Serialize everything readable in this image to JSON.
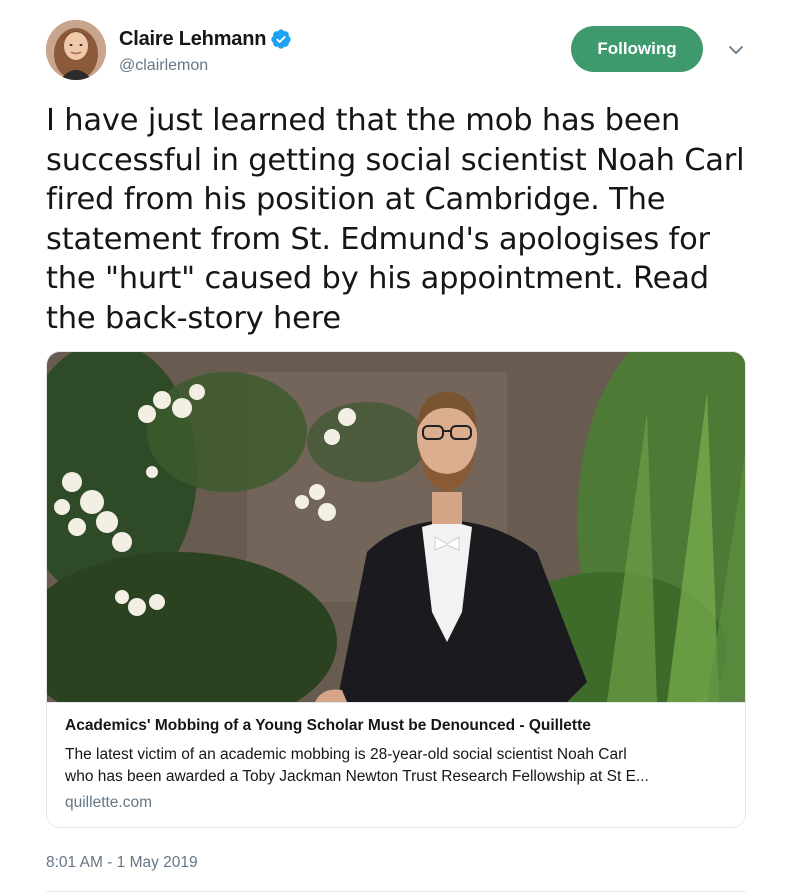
{
  "author": {
    "display_name": "Claire Lehmann",
    "handle": "@clairlemon",
    "verified": true,
    "avatar_icon": "profile-photo"
  },
  "actions": {
    "follow_label": "Following",
    "menu_icon": "chevron-down-icon"
  },
  "tweet": {
    "lines": [
      "I have just learned that the mob has been",
      "successful in getting social scientist Noah Carl",
      "fired from his position at Cambridge. The",
      "statement from St. Edmund's apologises for",
      "the \"hurt\" caused by his appointment. Read",
      "the back-story here"
    ],
    "timestamp": "8:01 AM - 1 May 2019"
  },
  "card": {
    "image_icon": "photo-man-in-academic-gown",
    "title": "Academics' Mobbing of a Young Scholar Must be Denounced - Quillette",
    "desc_lines": [
      "The latest victim of an academic mobbing is 28-year-old social scientist Noah Carl",
      "who has been awarded a Toby Jackman Newton Trust Research Fellowship at St E..."
    ],
    "domain": "quillette.com"
  },
  "colors": {
    "follow_bg": "#3e9a6d",
    "verified": "#1da1f2",
    "secondary_text": "#657786",
    "border": "#e1e8ed"
  }
}
